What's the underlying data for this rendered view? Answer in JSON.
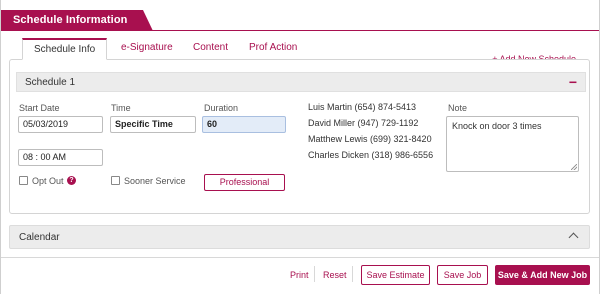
{
  "header": {
    "title": "Schedule Information"
  },
  "tabs": [
    {
      "label": "Schedule Info",
      "active": true
    },
    {
      "label": "e-Signature",
      "active": false
    },
    {
      "label": "Content",
      "active": false
    },
    {
      "label": "Prof Action",
      "active": false
    }
  ],
  "add_schedule_label": "+ Add New Schedule",
  "schedule": {
    "title": "Schedule 1",
    "collapse_symbol": "−",
    "start_date_label": "Start Date",
    "start_date_value": "05/03/2019",
    "time_label": "Time",
    "time_value": "Specific Time",
    "duration_label": "Duration",
    "duration_value": "60",
    "time_input_value": "08 : 00 AM",
    "opt_out_label": "Opt Out",
    "help_symbol": "?",
    "sooner_service_label": "Sooner Service",
    "professional_button": "Professional",
    "contacts": [
      "Luis Martin (654) 874-5413",
      "David Miller (947) 729-1192",
      "Matthew Lewis (699) 321-8420",
      "Charles Dicken (318) 986-6556"
    ],
    "note_label": "Note",
    "note_value": "Knock on door 3 times"
  },
  "calendar": {
    "title": "Calendar"
  },
  "footer": {
    "print": "Print",
    "reset": "Reset",
    "save_estimate": "Save Estimate",
    "save_job": "Save Job",
    "save_add_new_job": "Save & Add New Job"
  },
  "colors": {
    "accent": "#a8104f",
    "panel_bg": "#ececec",
    "highlight_input": "#e3ecf8"
  },
  "icons": {
    "collapse": "minus-icon",
    "calendar_toggle": "chevron-up-icon",
    "help": "question-circle-icon"
  }
}
